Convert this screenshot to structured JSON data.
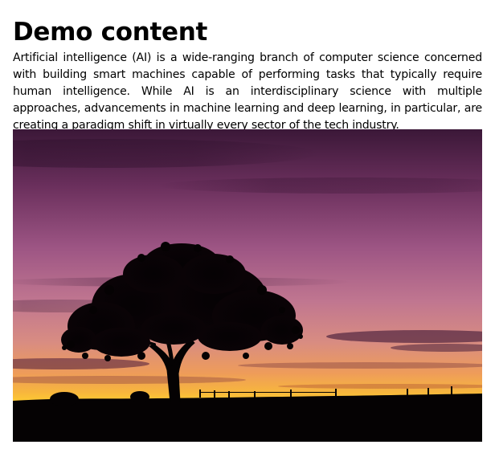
{
  "page": {
    "title": "Demo content",
    "paragraph": "Artificial intelligence (AI) is a wide-ranging branch of computer science concerned with building smart machines capable of performing tasks that typically require human intelligence. While AI is an interdisciplinary science with multiple approaches, advancements in machine learning and deep learning, in particular, are creating a paradigm shift in virtually every sector of the tech industry."
  },
  "image": {
    "subject": "tree-silhouette-sunset",
    "colors": {
      "sky_top": "#3a1a3a",
      "sky_mid": "#8c4a7c",
      "sky_pink": "#c97a96",
      "sky_orange": "#f2a04a",
      "horizon": "#ffcc33",
      "silhouette": "#000000"
    }
  }
}
